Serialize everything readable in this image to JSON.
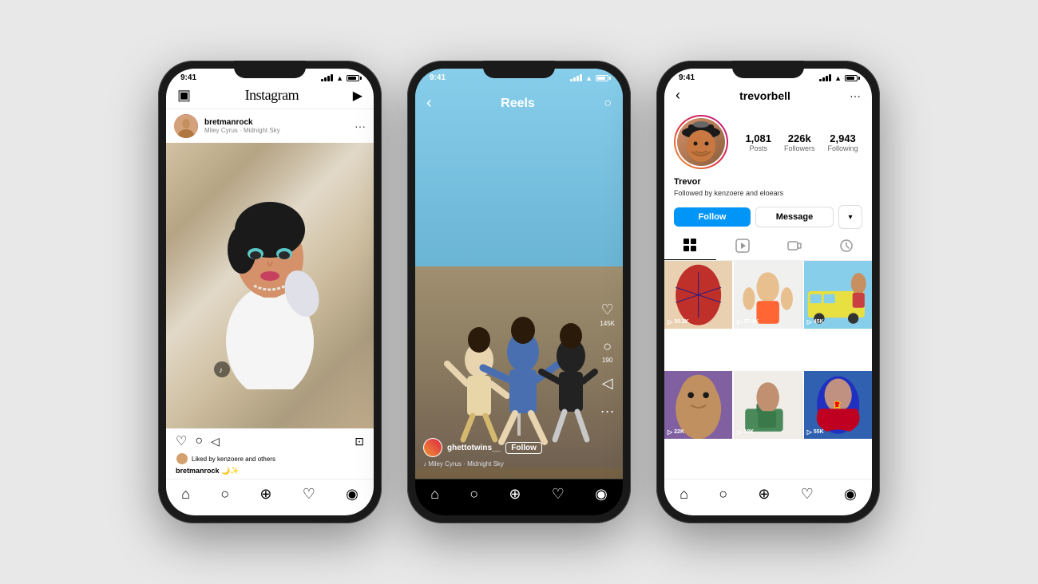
{
  "page": {
    "bg_color": "#e8e8e8"
  },
  "phone1": {
    "status": {
      "time": "9:41",
      "bars": [
        2,
        3,
        4,
        5,
        6
      ],
      "wifi": "wifi",
      "battery": 80
    },
    "header": {
      "logo": "Instagram",
      "camera_label": "camera-icon",
      "send_label": "send-icon"
    },
    "post": {
      "username": "bretmanrock",
      "subtitle": "Miley Cyrus · Midnight Sky",
      "more_label": "···"
    },
    "actions": {
      "like": "♡",
      "comment": "○",
      "share": "◁",
      "bookmark": "⊡"
    },
    "liked_by": {
      "text": "Liked by kenzoere and others"
    },
    "caption": {
      "username": "bretmanrock",
      "text": "🌙✨"
    },
    "music_badge": "♪",
    "nav": {
      "home": "⌂",
      "search": "○",
      "plus": "⊕",
      "heart": "♡",
      "person": "◉"
    }
  },
  "phone2": {
    "status": {
      "time": "9:41"
    },
    "header": {
      "back": "‹",
      "title": "Reels",
      "camera": "○"
    },
    "reel": {
      "username": "ghettotwins__",
      "follow_label": "Follow",
      "music": "♪ Miley Cyrus · Midnight Sky",
      "likes": "145K",
      "comments": "190"
    },
    "nav": {
      "home": "⌂",
      "search": "○",
      "plus": "⊕",
      "heart": "♡",
      "person": "◉"
    }
  },
  "phone3": {
    "status": {
      "time": "9:41"
    },
    "header": {
      "back": "‹",
      "username": "trevorbell",
      "more": "···"
    },
    "profile": {
      "name": "Trevor",
      "posts_count": "1,081",
      "posts_label": "Posts",
      "followers_count": "226k",
      "followers_label": "Followers",
      "following_count": "2,943",
      "following_label": "Following"
    },
    "followed_by": "Followed by kenzoere and eloears",
    "buttons": {
      "follow": "Follow",
      "message": "Message",
      "more_arrow": "▾"
    },
    "grid_items": [
      {
        "count": "30.2K",
        "color": "thumb-1"
      },
      {
        "count": "37.3K",
        "color": "thumb-2"
      },
      {
        "count": "45K",
        "color": "thumb-3"
      },
      {
        "count": "22K",
        "color": "thumb-4"
      },
      {
        "count": "18K",
        "color": "thumb-5"
      },
      {
        "count": "55K",
        "color": "thumb-6"
      }
    ],
    "nav": {
      "home": "⌂",
      "search": "○",
      "plus": "⊕",
      "heart": "♡",
      "person": "◉"
    }
  }
}
